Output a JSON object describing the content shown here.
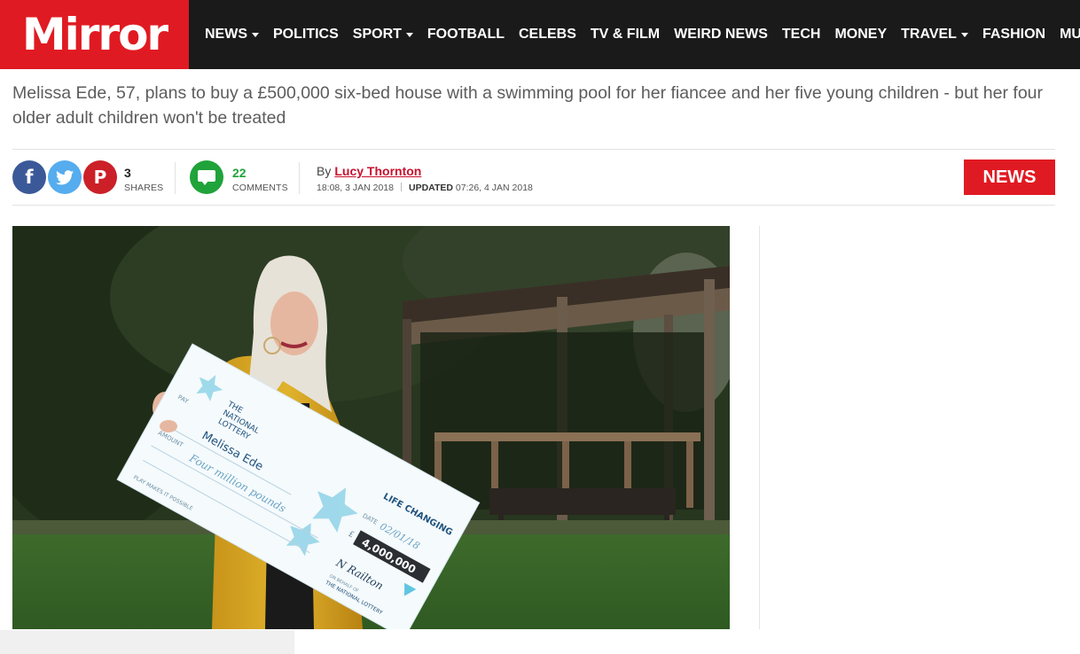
{
  "brand": {
    "logo_text": "Mirror",
    "accent_color": "#e01a22",
    "bar_color": "#1a1a1a"
  },
  "nav": [
    {
      "label": "NEWS",
      "dropdown": true
    },
    {
      "label": "POLITICS",
      "dropdown": false
    },
    {
      "label": "SPORT",
      "dropdown": true
    },
    {
      "label": "FOOTBALL",
      "dropdown": false
    },
    {
      "label": "CELEBS",
      "dropdown": false
    },
    {
      "label": "TV & FILM",
      "dropdown": false
    },
    {
      "label": "WEIRD NEWS",
      "dropdown": false
    },
    {
      "label": "TECH",
      "dropdown": false
    },
    {
      "label": "MONEY",
      "dropdown": false
    },
    {
      "label": "TRAVEL",
      "dropdown": true
    },
    {
      "label": "FASHION",
      "dropdown": false
    },
    {
      "label": "MUMS",
      "dropdown": false
    }
  ],
  "article": {
    "standfirst": "Melissa Ede, 57, plans to buy a £500,000 six-bed house with a swimming pool for her fiancee and her five young children - but her four older adult children won't be treated",
    "shares": {
      "count": "3",
      "label": "SHARES"
    },
    "comments": {
      "count": "22",
      "label": "COMMENTS"
    },
    "byline": {
      "prefix": "By",
      "author": "Lucy Thornton"
    },
    "published": "18:08, 3 JAN 2018",
    "updated_label": "UPDATED",
    "updated": "07:26, 4 JAN 2018",
    "section_tag": "NEWS"
  },
  "social_icons": {
    "facebook": "facebook-icon",
    "twitter": "twitter-icon",
    "pinterest": "pinterest-icon",
    "comments": "comment-icon"
  },
  "cheque": {
    "brand_line1": "THE",
    "brand_line2": "NATIONAL",
    "brand_line3": "LOTTERY",
    "pay_label": "PAY",
    "payee": "Melissa Ede",
    "amount_label": "AMOUNT",
    "amount_words": "Four million pounds",
    "tagline": "LIFE CHANGING",
    "date_label": "DATE",
    "date": "02/01/18",
    "currency": "£",
    "amount": "4,000,000",
    "signature": "N Railton",
    "footer_left": "PLAY MAKES IT POSSIBLE",
    "footer_right1": "ON BEHALF OF",
    "footer_right2": "THE NATIONAL LOTTERY"
  }
}
